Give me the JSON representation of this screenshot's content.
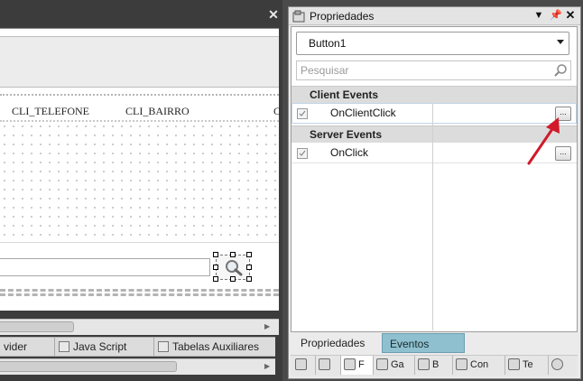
{
  "designer": {
    "columns": [
      "CLI_TELEFONE",
      "CLI_BAIRRO",
      "C"
    ],
    "tabs": [
      {
        "label": "vider",
        "icon": "provider-icon"
      },
      {
        "label": "Java Script",
        "icon": "javascript-icon"
      },
      {
        "label": "Tabelas Auxiliares",
        "icon": "table-icon"
      }
    ]
  },
  "panel": {
    "title": "Propriedades",
    "selected_object": "Button1",
    "search_placeholder": "Pesquisar",
    "categories": [
      {
        "label": "Client Events",
        "items": [
          {
            "name": "OnClientClick",
            "value": "",
            "button": "..."
          }
        ]
      },
      {
        "label": "Server Events",
        "items": [
          {
            "name": "OnClick",
            "value": "",
            "button": "..."
          }
        ]
      }
    ],
    "bottom_tabs": {
      "properties": "Propriedades",
      "events": "Eventos",
      "active": "Eventos"
    },
    "tool_tabs": [
      "",
      "",
      "F",
      "Ga",
      "B",
      "Con",
      "Te",
      ""
    ]
  },
  "colors": {
    "active_tab": "#8fc0cf",
    "annotation_arrow": "#d11a2a",
    "dark_bg": "#3c3c3c"
  }
}
